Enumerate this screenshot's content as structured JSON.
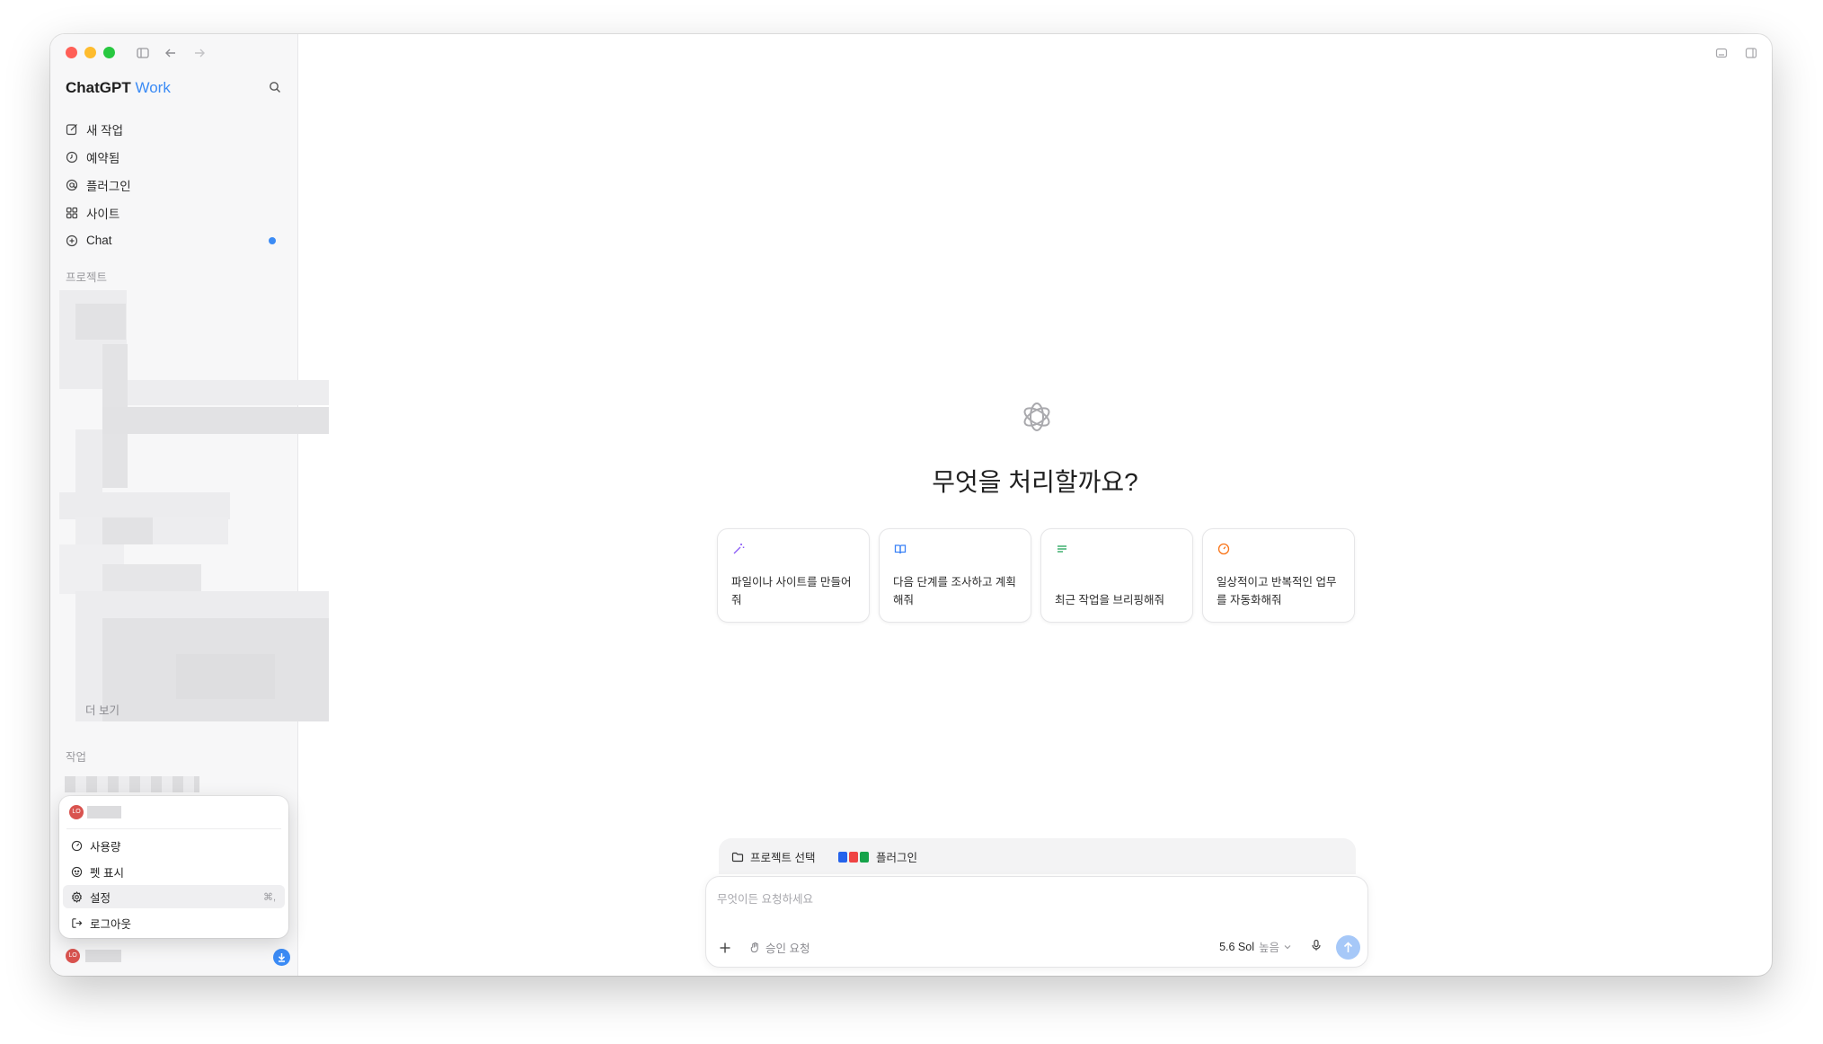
{
  "app": {
    "brand_name": "ChatGPT",
    "brand_suffix": "Work"
  },
  "sidebar": {
    "nav": [
      {
        "label": "새 작업",
        "icon": "edit-icon"
      },
      {
        "label": "예약됨",
        "icon": "clock-icon"
      },
      {
        "label": "플러그인",
        "icon": "at-icon"
      },
      {
        "label": "사이트",
        "icon": "grid-icon"
      },
      {
        "label": "Chat",
        "icon": "chat-plus-icon",
        "has_unread_dot": true
      }
    ],
    "projects_label": "프로젝트",
    "more_label": "더 보기",
    "tasks_label": "작업",
    "user_initials": "LO"
  },
  "account_menu": {
    "items": [
      {
        "label": "사용량",
        "icon": "gauge-icon"
      },
      {
        "label": "펫 표시",
        "icon": "pet-icon"
      },
      {
        "label": "설정",
        "icon": "gear-icon",
        "shortcut": "⌘,",
        "highlighted": true
      },
      {
        "label": "로그아웃",
        "icon": "logout-icon"
      }
    ]
  },
  "main": {
    "headline": "무엇을 처리할까요?",
    "suggestions": [
      {
        "text": "파일이나 사이트를 만들어 줘",
        "icon": "magic-wand-icon",
        "icon_color": "#8b5cf6"
      },
      {
        "text": "다음 단계를 조사하고 계획해줘",
        "icon": "book-icon",
        "icon_color": "#3b82f6"
      },
      {
        "text": "최근 작업을 브리핑해줘",
        "icon": "list-icon",
        "icon_color": "#22a55a"
      },
      {
        "text": "일상적이고 반복적인 업무를 자동화해줘",
        "icon": "timer-icon",
        "icon_color": "#f97316"
      }
    ],
    "composer": {
      "project_select_label": "프로젝트 선택",
      "plugins_label": "플러그인",
      "placeholder": "무엇이든 요청하세요",
      "approval_label": "승인 요청",
      "model_label": "5.6 Sol",
      "effort_label": "높음"
    }
  },
  "colors": {
    "accent": "#3b8bf5",
    "sidebar_bg": "#f7f7f8",
    "send_button": "#a6c8f8"
  }
}
